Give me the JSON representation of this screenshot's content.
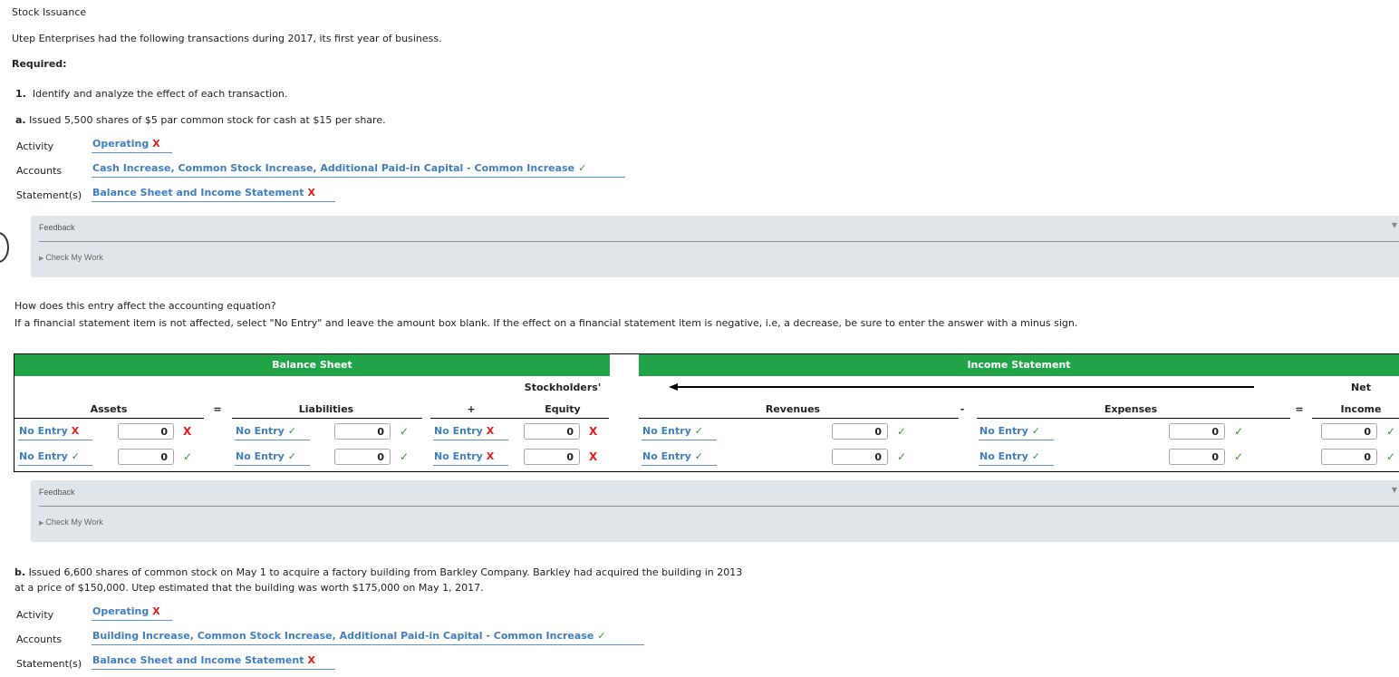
{
  "header": {
    "title": "Stock Issuance",
    "intro": "Utep Enterprises had the following transactions during 2017, its first year of business.",
    "required_label": "Required:",
    "req1_num": "1.",
    "req1_text": "Identify and analyze the effect of each transaction."
  },
  "transaction_a": {
    "letter": "a.",
    "text": "Issued 5,500 shares of $5 par common stock for cash at $15 per share.",
    "activity": {
      "label": "Activity",
      "value": "Operating",
      "result": "incorrect"
    },
    "accounts": {
      "label": "Accounts",
      "value": "Cash Increase, Common Stock Increase, Additional Paid-in Capital - Common Increase",
      "result": "correct"
    },
    "statements": {
      "label": "Statement(s)",
      "value": "Balance Sheet and Income Statement",
      "result": "incorrect"
    }
  },
  "feedback": {
    "title": "Feedback",
    "check_label": "Check My Work"
  },
  "equation": {
    "question": "How does this entry affect the accounting equation?",
    "instruction": "If a financial statement item is not affected, select \"No Entry\" and leave the amount box blank. If the effect on a financial statement item is negative, i.e, a decrease, be sure to enter the answer with a minus sign.",
    "balance_sheet_label": "Balance Sheet",
    "income_statement_label": "Income Statement",
    "headers": {
      "assets": "Assets",
      "eq1": "=",
      "liabilities": "Liabilities",
      "plus": "+",
      "se_top": "Stockholders'",
      "se_bottom": "Equity",
      "revenues": "Revenues",
      "minus": "-",
      "expenses": "Expenses",
      "eq2": "=",
      "ni_top": "Net",
      "ni_bottom": "Income"
    },
    "rows": [
      {
        "assets": {
          "select": "No Entry",
          "select_result": "incorrect",
          "amount": "0",
          "amount_result": "incorrect"
        },
        "liabilities": {
          "select": "No Entry",
          "select_result": "correct",
          "amount": "0",
          "amount_result": "correct"
        },
        "equity": {
          "select": "No Entry",
          "select_result": "incorrect",
          "amount": "0",
          "amount_result": "incorrect"
        },
        "revenues": {
          "select": "No Entry",
          "select_result": "correct",
          "amount": "0",
          "amount_result": "correct"
        },
        "expenses": {
          "select": "No Entry",
          "select_result": "correct",
          "amount": "0",
          "amount_result": "correct"
        },
        "net_income": {
          "amount": "0",
          "amount_result": "correct"
        }
      },
      {
        "assets": {
          "select": "No Entry",
          "select_result": "correct",
          "amount": "0",
          "amount_result": "correct"
        },
        "liabilities": {
          "select": "No Entry",
          "select_result": "correct",
          "amount": "0",
          "amount_result": "correct"
        },
        "equity": {
          "select": "No Entry",
          "select_result": "incorrect",
          "amount": "0",
          "amount_result": "incorrect"
        },
        "revenues": {
          "select": "No Entry",
          "select_result": "correct",
          "amount": "0",
          "amount_result": "correct"
        },
        "expenses": {
          "select": "No Entry",
          "select_result": "correct",
          "amount": "0",
          "amount_result": "correct"
        },
        "net_income": {
          "amount": "0",
          "amount_result": "correct"
        }
      }
    ]
  },
  "transaction_b": {
    "letter": "b.",
    "text_line1": "Issued 6,600 shares of common stock on May 1 to acquire a factory building from Barkley Company. Barkley had acquired the building in 2013",
    "text_line2": "at a price of $150,000. Utep estimated that the building was worth $175,000 on May 1, 2017.",
    "activity": {
      "label": "Activity",
      "value": "Operating",
      "result": "incorrect"
    },
    "accounts": {
      "label": "Accounts",
      "value": "Building Increase, Common Stock Increase, Additional Paid-in Capital - Common Increase",
      "result": "correct"
    },
    "statements": {
      "label": "Statement(s)",
      "value": "Balance Sheet and Income Statement",
      "result": "incorrect"
    }
  },
  "marks": {
    "correct": "✓",
    "incorrect": "X"
  },
  "colors": {
    "green_header": "#21a347",
    "link_blue": "#3f7fbf",
    "error_red": "#e21c1c",
    "ok_green": "#2e9a2e",
    "feedback_bg": "#dfe5e8"
  }
}
